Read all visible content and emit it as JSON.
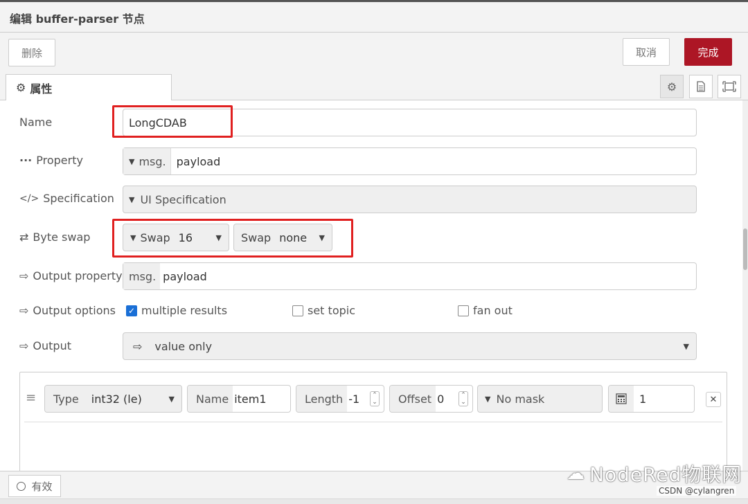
{
  "window": {
    "title": "编辑 buffer-parser 节点"
  },
  "toolbar": {
    "delete_label": "删除",
    "cancel_label": "取消",
    "done_label": "完成"
  },
  "tabs": {
    "properties_label": "属性"
  },
  "form": {
    "name": {
      "label": "Name",
      "value": "LongCDAB"
    },
    "property": {
      "label": "Property",
      "prefix": "msg.",
      "value": "payload"
    },
    "specification": {
      "label": "Specification",
      "value": "UI Specification"
    },
    "byte_swap": {
      "label": "Byte swap",
      "swap1": {
        "key": "Swap",
        "value": "16"
      },
      "swap2": {
        "key": "Swap",
        "value": "none"
      }
    },
    "output_property": {
      "label": "Output property",
      "prefix": "msg.",
      "value": "payload"
    },
    "output_options": {
      "label": "Output options",
      "multiple_results": {
        "label": "multiple results",
        "checked": true
      },
      "set_topic": {
        "label": "set topic",
        "checked": false
      },
      "fan_out": {
        "label": "fan out",
        "checked": false
      }
    },
    "output": {
      "label": "Output",
      "value": "value only"
    }
  },
  "items": [
    {
      "type_key": "Type",
      "type_value": "int32 (le)",
      "name_key": "Name",
      "name_value": "item1",
      "length_key": "Length",
      "length_value": "-1",
      "offset_key": "Offset",
      "offset_value": "0",
      "mask_value": "No mask",
      "count_value": "1"
    }
  ],
  "footer": {
    "valid_label": "有效"
  },
  "watermark": {
    "text": "NodeRed物联网",
    "credit": "CSDN @cylangren"
  },
  "colors": {
    "done_button": "#ad1625",
    "highlight": "#e02020",
    "checkbox": "#1a6fd6"
  }
}
